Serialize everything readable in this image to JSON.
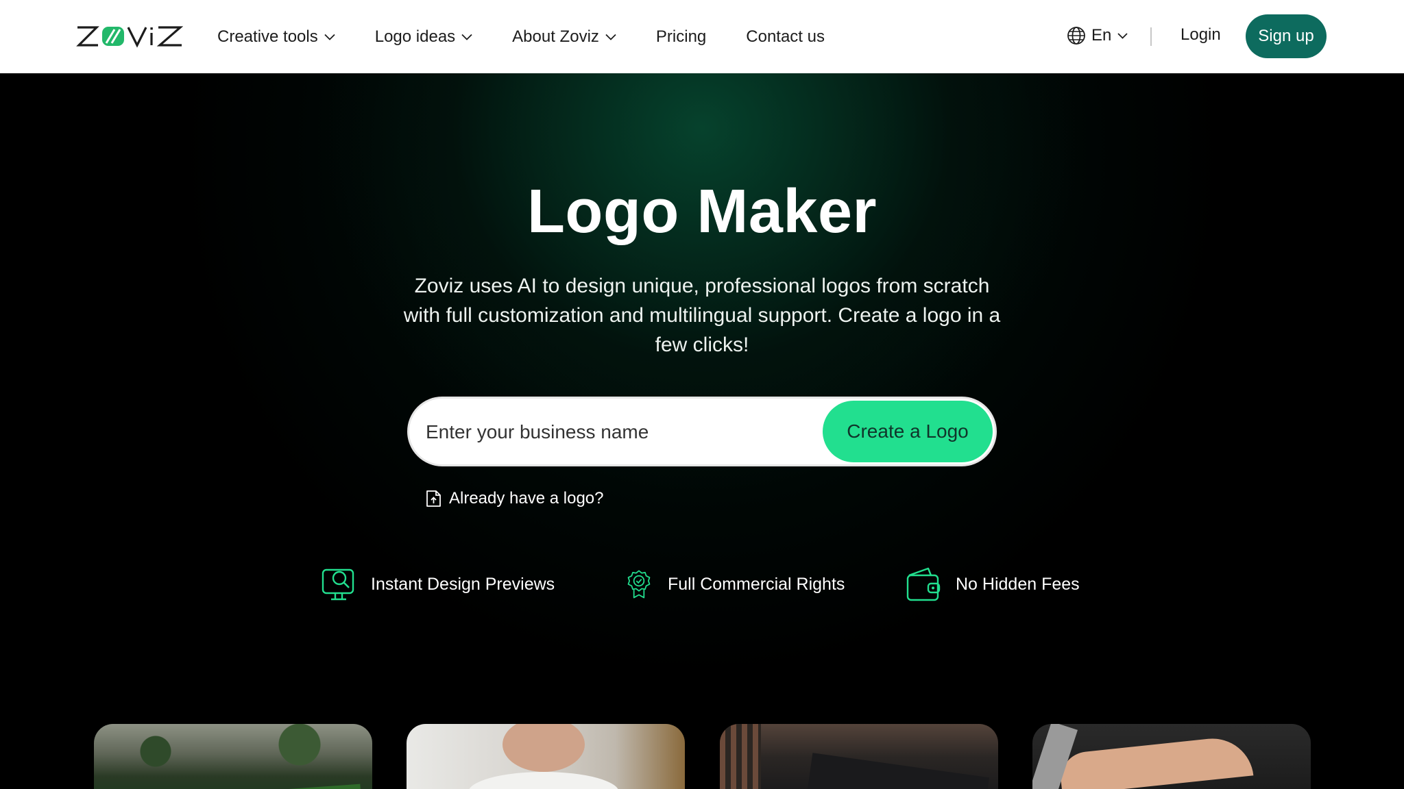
{
  "brand": {
    "name": "ZOVIZ",
    "accent": "#22df8f",
    "primary": "#0d6b5e"
  },
  "nav": {
    "items": [
      {
        "label": "Creative tools",
        "dropdown": true
      },
      {
        "label": "Logo ideas",
        "dropdown": true
      },
      {
        "label": "About Zoviz",
        "dropdown": true
      },
      {
        "label": "Pricing",
        "dropdown": false
      },
      {
        "label": "Contact us",
        "dropdown": false
      }
    ],
    "language": "En",
    "login": "Login",
    "signup": "Sign up"
  },
  "hero": {
    "title": "Logo Maker",
    "subtitle": "Zoviz uses AI to design unique, professional logos from scratch with full customization and multilingual support. Create a logo in a few clicks!",
    "search": {
      "placeholder": "Enter your business name",
      "value": ""
    },
    "cta": "Create a Logo",
    "already": "Already have a logo?"
  },
  "features": [
    {
      "label": "Instant Design Previews",
      "icon": "monitor-search-icon"
    },
    {
      "label": "Full Commercial Rights",
      "icon": "award-badge-icon"
    },
    {
      "label": "No Hidden Fees",
      "icon": "wallet-icon"
    }
  ]
}
